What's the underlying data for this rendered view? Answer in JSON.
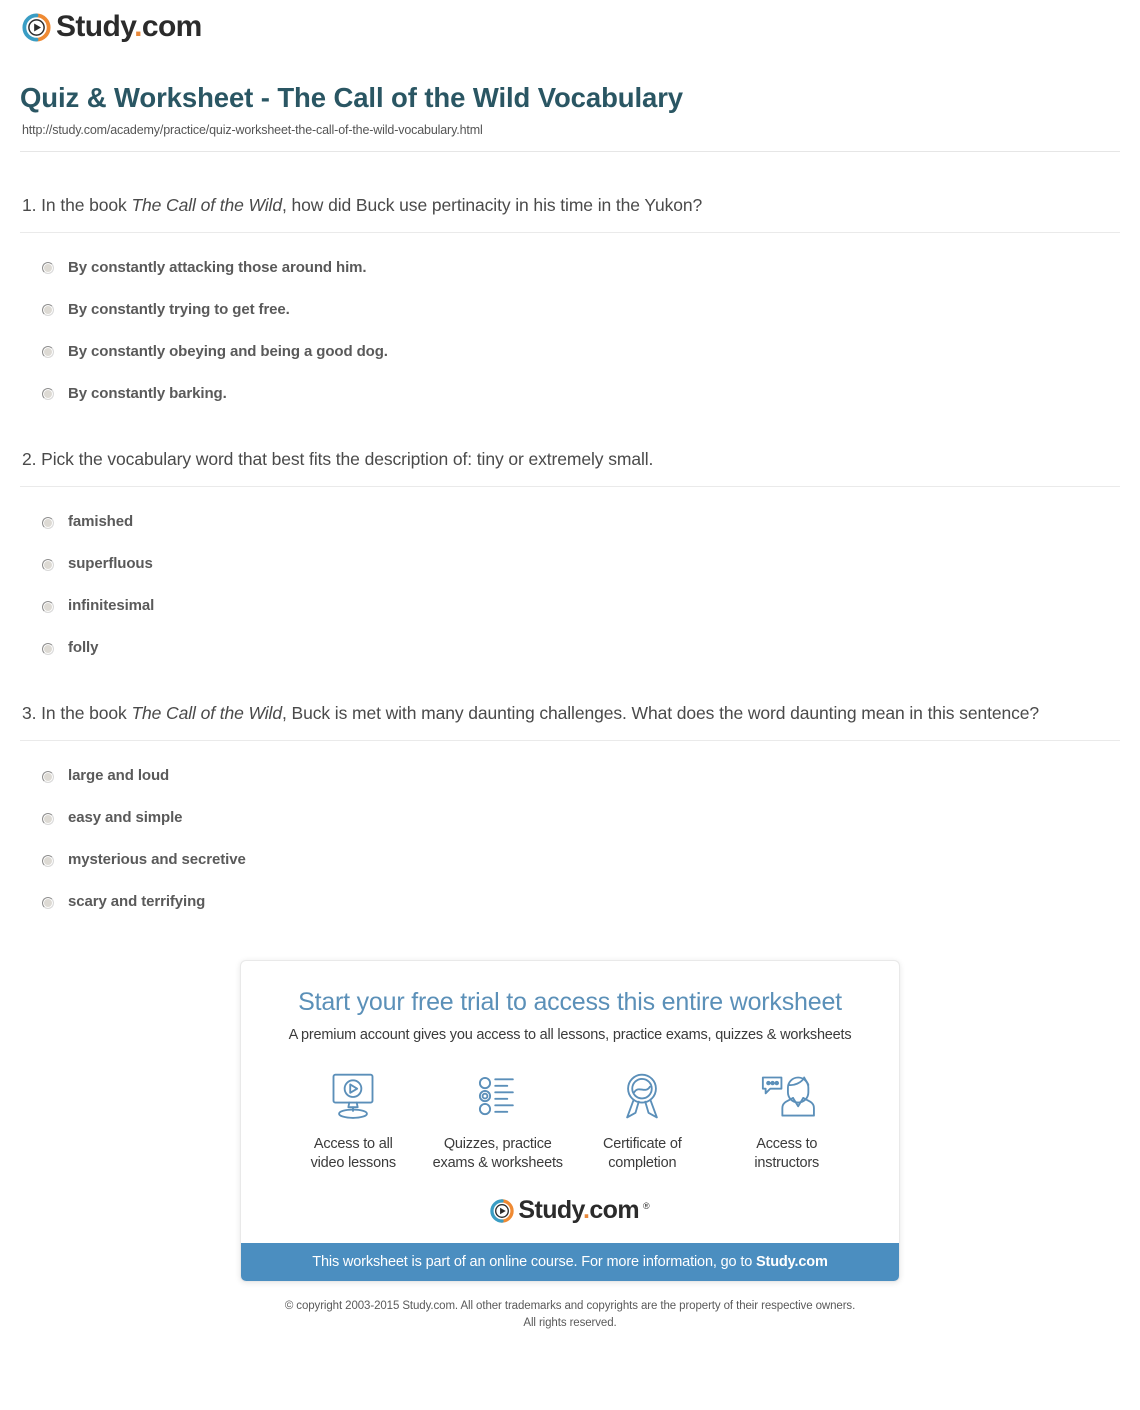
{
  "brand": {
    "name_main": "Study",
    "name_dot": ".",
    "name_tld": "com",
    "trademark": "®",
    "logo_blue": "#3a9dc4",
    "logo_orange": "#ef8a33",
    "logo_text_color": "#2b2b2b"
  },
  "header": {
    "title": "Quiz & Worksheet - The Call of the Wild Vocabulary",
    "url": "http://study.com/academy/practice/quiz-worksheet-the-call-of-the-wild-vocabulary.html",
    "title_color": "#2a5663"
  },
  "questions": [
    {
      "number": "1.",
      "text_before": "In the book ",
      "italic": "The Call of the Wild",
      "text_after": ", how did Buck use pertinacity in his time in the Yukon?",
      "options": [
        "By constantly attacking those around him.",
        "By constantly trying to get free.",
        "By constantly obeying and being a good dog.",
        "By constantly barking."
      ]
    },
    {
      "number": "2.",
      "text_before": "Pick the vocabulary word that best fits the description of: tiny or extremely small.",
      "italic": "",
      "text_after": "",
      "options": [
        "famished",
        "superfluous",
        "infinitesimal",
        "folly"
      ]
    },
    {
      "number": "3.",
      "text_before": "In the book ",
      "italic": "The Call of the Wild",
      "text_after": ", Buck is met with many daunting challenges. What does the word daunting mean in this sentence?",
      "options": [
        "large and loud",
        "easy and simple",
        "mysterious and secretive",
        "scary and terrifying"
      ]
    }
  ],
  "promo": {
    "headline": "Start your free trial to access this entire worksheet",
    "subhead": "A premium account gives you access to all lessons, practice exams, quizzes & worksheets",
    "features": [
      {
        "icon": "monitor-play-icon",
        "label_line1": "Access to all",
        "label_line2": "video lessons"
      },
      {
        "icon": "checklist-icon",
        "label_line1": "Quizzes, practice",
        "label_line2": "exams & worksheets"
      },
      {
        "icon": "award-ribbon-icon",
        "label_line1": "Certificate of",
        "label_line2": "completion"
      },
      {
        "icon": "instructor-chat-icon",
        "label_line1": "Access to",
        "label_line2": "instructors"
      }
    ],
    "bar_text": "This worksheet is part of an online course. For more information, go to ",
    "bar_link": "Study.com",
    "bar_color": "#4b8ec0",
    "headline_color": "#5b90b8"
  },
  "footer": {
    "line1": "© copyright 2003-2015 Study.com. All other trademarks and copyrights are the property of their respective owners.",
    "line2": "All rights reserved."
  }
}
